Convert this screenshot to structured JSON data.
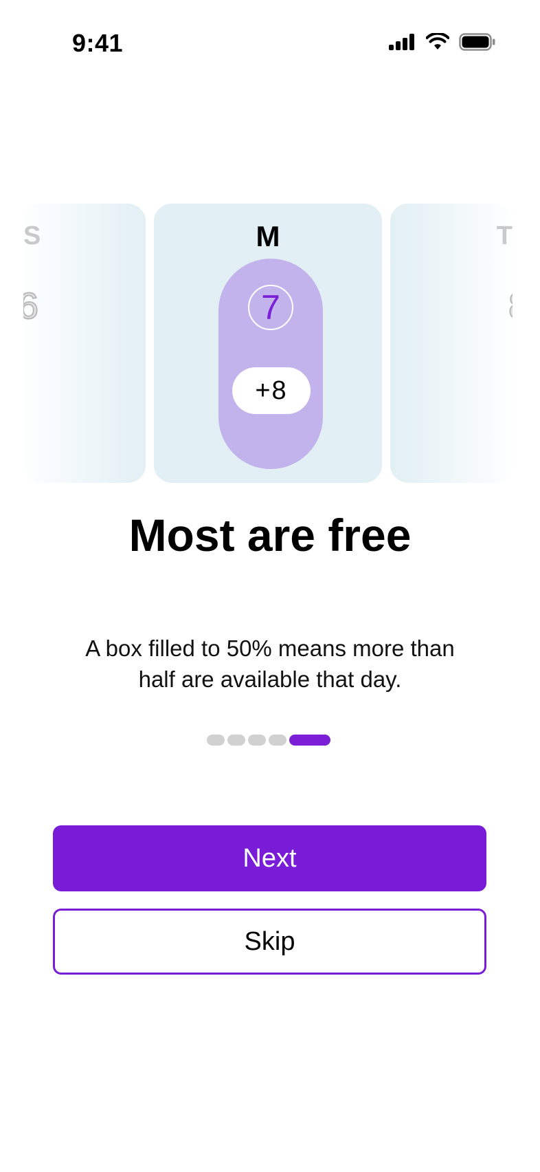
{
  "status_bar": {
    "time": "9:41",
    "icons": [
      "cellular-signal-icon",
      "wifi-icon",
      "battery-icon"
    ]
  },
  "carousel": {
    "previous_day": {
      "letter": "S",
      "date": "6"
    },
    "current_day": {
      "letter": "M",
      "date": "7",
      "extra_count": "+8"
    },
    "next_day": {
      "letter": "T",
      "date": "8"
    }
  },
  "onboarding": {
    "title": "Most are free",
    "description": "A box filled to 50% means more than half are available that day.",
    "page_count": 5,
    "current_page": 5
  },
  "actions": {
    "next_label": "Next",
    "skip_label": "Skip"
  },
  "colors": {
    "accent": "#781cd7",
    "card_background": "#e2eff4",
    "pill_fill": "#c3b3ec",
    "inactive_dot": "#d1d1d1"
  }
}
